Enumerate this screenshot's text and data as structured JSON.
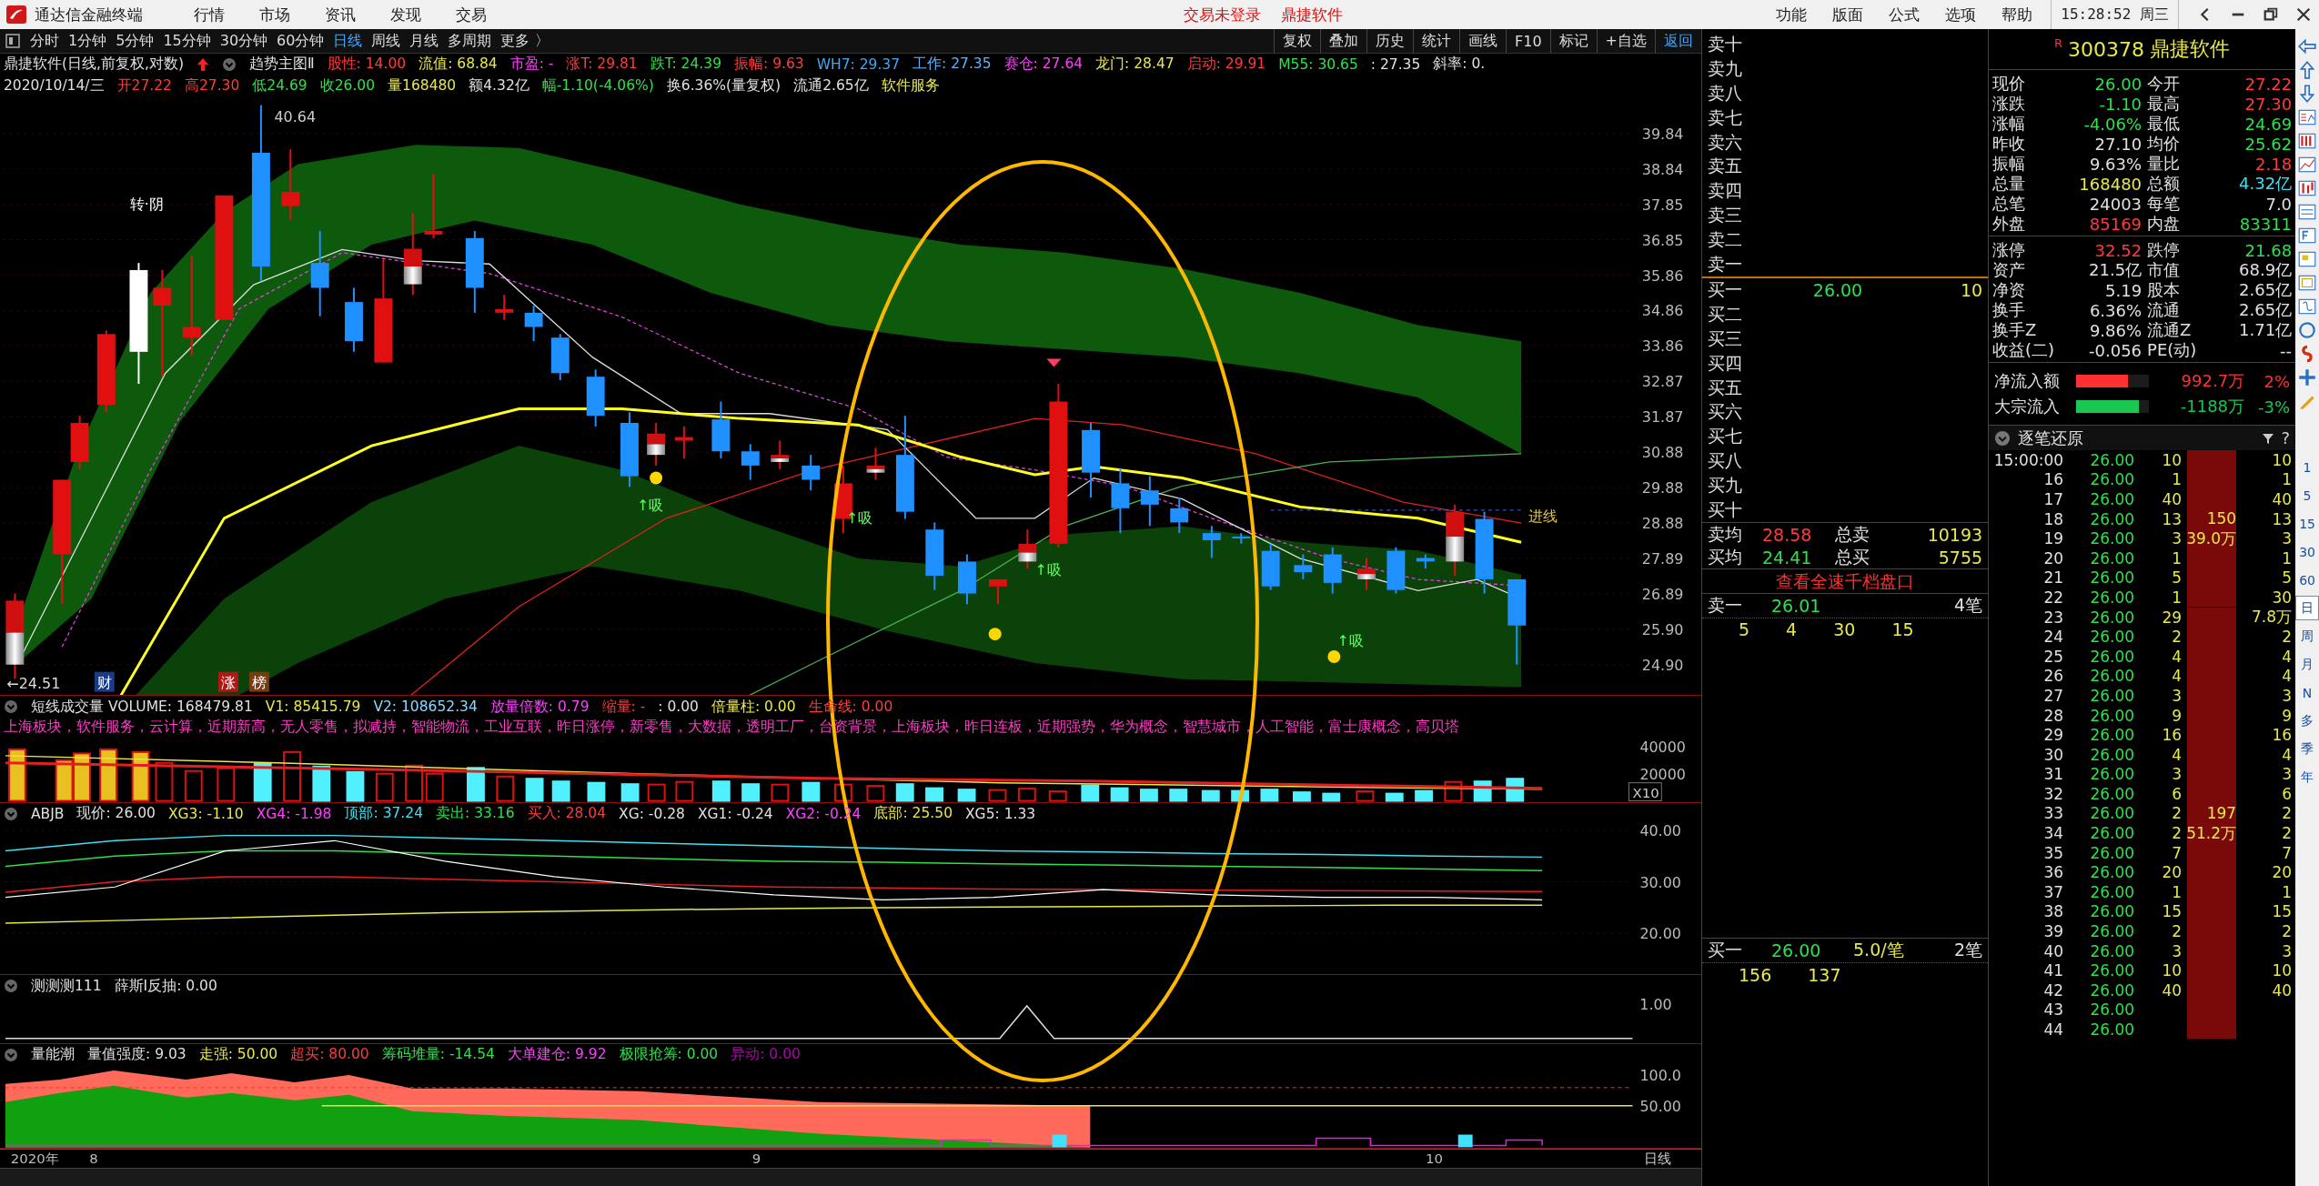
{
  "title_bar": {
    "app_name": "通达信金融终端",
    "menu": [
      "行情",
      "市场",
      "资讯",
      "发现",
      "交易"
    ],
    "notices": [
      "交易未登录",
      "鼎捷软件"
    ],
    "right_menu": [
      "功能",
      "版面",
      "公式",
      "选项",
      "帮助"
    ],
    "clock": "15:28:52 周三"
  },
  "period_tabs": [
    {
      "label": "分时",
      "selected": false
    },
    {
      "label": "1分钟",
      "selected": false
    },
    {
      "label": "5分钟",
      "selected": false
    },
    {
      "label": "15分钟",
      "selected": false
    },
    {
      "label": "30分钟",
      "selected": false
    },
    {
      "label": "60分钟",
      "selected": false
    },
    {
      "label": "日线",
      "selected": true
    },
    {
      "label": "周线",
      "selected": false
    },
    {
      "label": "月线",
      "selected": false
    },
    {
      "label": "多周期",
      "selected": false
    },
    {
      "label": "更多 〉",
      "selected": false
    }
  ],
  "tool_buttons": [
    {
      "label": "复权",
      "selected": false
    },
    {
      "label": "叠加",
      "selected": false
    },
    {
      "label": "历史",
      "selected": false
    },
    {
      "label": "统计",
      "selected": false
    },
    {
      "label": "画线",
      "selected": false
    },
    {
      "label": "F10",
      "selected": false
    },
    {
      "label": "标记",
      "selected": false
    },
    {
      "label": "+自选",
      "selected": false
    },
    {
      "label": "返回",
      "selected": true
    }
  ],
  "main_chart": {
    "title": "鼎捷软件(日线,前复权,对数)",
    "indicator_name": "趋势主图Ⅱ",
    "indicators": [
      {
        "text": "股性: 14.00",
        "color": "#ff3b3b"
      },
      {
        "text": "流值: 68.84",
        "color": "#e8e84a"
      },
      {
        "text": "市盈: -",
        "color": "#ff40ff"
      },
      {
        "text": "涨T: 29.81",
        "color": "#ff3b3b"
      },
      {
        "text": "跌T: 24.39",
        "color": "#2ee04a"
      },
      {
        "text": "振幅: 9.63",
        "color": "#ff3b3b"
      },
      {
        "text": "WH7: 29.37",
        "color": "#3fa9f5"
      },
      {
        "text": "工作: 27.35",
        "color": "#5ab4ff"
      },
      {
        "text": "赛仓: 27.64",
        "color": "#ff40ff"
      },
      {
        "text": "龙门: 28.47",
        "color": "#e8e84a"
      },
      {
        "text": "启动: 29.91",
        "color": "#ff3b3b"
      },
      {
        "text": "M55: 30.65",
        "color": "#2ee04a"
      },
      {
        "text": ": 27.35",
        "color": "#e0e0e0"
      },
      {
        "text": "斜率: 0.",
        "color": "#e0e0e0"
      }
    ],
    "date_line": [
      {
        "text": "2020/10/14/三",
        "color": "#e0e0e0"
      },
      {
        "text": "开27.22",
        "color": "#ff3b3b"
      },
      {
        "text": "高27.30",
        "color": "#ff3b3b"
      },
      {
        "text": "低24.69",
        "color": "#2ee04a"
      },
      {
        "text": "收26.00",
        "color": "#2ee04a"
      },
      {
        "text": "量168480",
        "color": "#e8e84a"
      },
      {
        "text": "额4.32亿",
        "color": "#e0e0e0"
      },
      {
        "text": "幅-1.10(-4.06%)",
        "color": "#2ee04a"
      },
      {
        "text": "换6.36%(量复权)",
        "color": "#e0e0e0"
      },
      {
        "text": "流通2.65亿",
        "color": "#e0e0e0"
      },
      {
        "text": "软件服务",
        "color": "#e8e84a"
      }
    ],
    "price_axis": [
      "39.84",
      "38.84",
      "37.85",
      "36.85",
      "35.86",
      "34.86",
      "33.86",
      "32.87",
      "31.87",
      "30.88",
      "29.88",
      "28.88",
      "27.89",
      "26.89",
      "25.90",
      "24.90"
    ],
    "high_label": "40.64",
    "low_label": "←24.51",
    "turn_label": "转·阴",
    "marks": [
      {
        "text": "财",
        "color": "#1a3a8a"
      },
      {
        "text": "涨",
        "color": "#b01818"
      },
      {
        "text": "榜",
        "color": "#7a3a10"
      }
    ],
    "buy_signals": [
      "↑吸",
      "↑吸",
      "↑吸",
      "↑吸"
    ],
    "entry_label": "进线"
  },
  "volume_panel": {
    "values": [
      {
        "text": "短线成交量 VOLUME: 168479.81",
        "color": "#e0e0e0"
      },
      {
        "text": "V1: 85415.79",
        "color": "#e8e84a"
      },
      {
        "text": "V2: 108652.34",
        "color": "#8fd8ff"
      },
      {
        "text": "放量倍数: 0.79",
        "color": "#ff40ff"
      },
      {
        "text": "缩量: -",
        "color": "#ff3b3b"
      },
      {
        "text": ": 0.00",
        "color": "#e0e0e0"
      },
      {
        "text": "倍量柱: 0.00",
        "color": "#e8e84a"
      },
      {
        "text": "生命线: 0.00",
        "color": "#ff3b3b"
      }
    ],
    "concepts": "上海板块，软件服务，云计算，近期新高，无人零售，拟减持，智能物流，工业互联，昨日涨停，新零售，大数据，透明工厂，台资背景，上海板块，昨日连板，近期强势，华为概念，智慧城市，人工智能，富士康概念，高贝塔",
    "axis": [
      "40000",
      "20000"
    ],
    "scale_tag": "X10"
  },
  "abjb_panel": {
    "values": [
      {
        "text": "ABJB",
        "color": "#e0e0e0"
      },
      {
        "text": "现价: 26.00",
        "color": "#e0e0e0"
      },
      {
        "text": "XG3: -1.10",
        "color": "#e8e84a"
      },
      {
        "text": "XG4: -1.98",
        "color": "#ff40ff"
      },
      {
        "text": "顶部: 37.24",
        "color": "#40e0f0"
      },
      {
        "text": "卖出: 33.16",
        "color": "#2ee04a"
      },
      {
        "text": "买入: 28.04",
        "color": "#ff3b3b"
      },
      {
        "text": "XG: -0.28",
        "color": "#e0e0e0"
      },
      {
        "text": "XG1: -0.24",
        "color": "#e0e0e0"
      },
      {
        "text": "XG2: -0.24",
        "color": "#ff40ff"
      },
      {
        "text": "底部: 25.50",
        "color": "#e8e84a"
      },
      {
        "text": "XG5: 1.33",
        "color": "#e0e0e0"
      }
    ],
    "axis": [
      "40.00",
      "30.00",
      "20.00"
    ]
  },
  "test_panel": {
    "values": [
      {
        "text": "测测测111",
        "color": "#e0e0e0"
      },
      {
        "text": "薛斯Ⅰ反抽: 0.00",
        "color": "#e0e0e0"
      }
    ],
    "axis": [
      "1.00"
    ]
  },
  "energy_panel": {
    "values": [
      {
        "text": "量能潮",
        "color": "#e0e0e0"
      },
      {
        "text": "量值强度: 9.03",
        "color": "#e0e0e0"
      },
      {
        "text": "走强: 50.00",
        "color": "#e8e84a"
      },
      {
        "text": "超买: 80.00",
        "color": "#ff3b3b"
      },
      {
        "text": "筹码堆量: -14.54",
        "color": "#2ee04a"
      },
      {
        "text": "大单建仓: 9.92",
        "color": "#ff40ff"
      },
      {
        "text": "极限抢筹: 0.00",
        "color": "#2ee04a"
      },
      {
        "text": "异动: 0.00",
        "color": "#b000b0"
      }
    ],
    "axis": [
      "100.0",
      "50.00"
    ]
  },
  "date_axis": {
    "labels": [
      "2020年",
      "8",
      "9",
      "10"
    ],
    "period": "日线"
  },
  "order_book": {
    "asks": [
      "卖十",
      "卖九",
      "卖八",
      "卖七",
      "卖六",
      "卖五",
      "卖四",
      "卖三",
      "卖二",
      "卖一"
    ],
    "bids": [
      {
        "label": "买一",
        "price": "26.00",
        "volume": "10"
      },
      {
        "label": "买二"
      },
      {
        "label": "买三"
      },
      {
        "label": "买四"
      },
      {
        "label": "买五"
      },
      {
        "label": "买六"
      },
      {
        "label": "买七"
      },
      {
        "label": "买八"
      },
      {
        "label": "买九"
      },
      {
        "label": "买十"
      }
    ],
    "summary": [
      {
        "label": "卖均",
        "value": "28.58",
        "color": "#ff3b3b",
        "label2": "总卖",
        "value2": "10193"
      },
      {
        "label": "买均",
        "value": "24.41",
        "color": "#2ee04a",
        "label2": "总买",
        "value2": "5755"
      }
    ],
    "full_depth_button": "查看全速千档盘口",
    "ask1": {
      "label": "卖一",
      "price": "26.01",
      "count": "4笔",
      "orders": [
        "5",
        "4",
        "30",
        "15"
      ]
    },
    "bid1": {
      "label": "买一",
      "price": "26.00",
      "average": "5.0/笔",
      "count": "2笔",
      "orders": [
        "156",
        "137"
      ]
    }
  },
  "quote": {
    "badge": "R",
    "code": "300378",
    "name": "鼎捷软件",
    "rows": [
      {
        "cells": [
          {
            "label": "现价",
            "value": "26.00",
            "color": "#2ee04a"
          },
          {
            "label": "今开",
            "value": "27.22",
            "color": "#ff3b3b"
          }
        ]
      },
      {
        "cells": [
          {
            "label": "涨跌",
            "value": "-1.10",
            "color": "#2ee04a"
          },
          {
            "label": "最高",
            "value": "27.30",
            "color": "#ff3b3b"
          }
        ]
      },
      {
        "cells": [
          {
            "label": "涨幅",
            "value": "-4.06%",
            "color": "#2ee04a"
          },
          {
            "label": "最低",
            "value": "24.69",
            "color": "#2ee04a"
          }
        ]
      },
      {
        "cells": [
          {
            "label": "昨收",
            "value": "27.10",
            "color": "#e0e0e0"
          },
          {
            "label": "均价",
            "value": "25.62",
            "color": "#2ee04a"
          }
        ]
      },
      {
        "cells": [
          {
            "label": "振幅",
            "value": "9.63%",
            "color": "#e0e0e0"
          },
          {
            "label": "量比",
            "value": "2.18",
            "color": "#ff3b3b"
          }
        ]
      },
      {
        "cells": [
          {
            "label": "总量",
            "value": "168480",
            "color": "#e8e84a"
          },
          {
            "label": "总额",
            "value": "4.32亿",
            "color": "#40e0f0"
          }
        ]
      },
      {
        "cells": [
          {
            "label": "总笔",
            "value": "24003",
            "color": "#e0e0e0"
          },
          {
            "label": "每笔",
            "value": "7.0",
            "color": "#e0e0e0"
          }
        ]
      },
      {
        "cells": [
          {
            "label": "外盘",
            "value": "85169",
            "color": "#ff3b3b"
          },
          {
            "label": "内盘",
            "value": "83311",
            "color": "#2ee04a"
          }
        ]
      }
    ],
    "rows2": [
      {
        "cells": [
          {
            "label": "涨停",
            "value": "32.52",
            "color": "#ff3b3b"
          },
          {
            "label": "跌停",
            "value": "21.68",
            "color": "#2ee04a"
          }
        ]
      },
      {
        "cells": [
          {
            "label": "资产",
            "value": "21.5亿",
            "color": "#e0e0e0"
          },
          {
            "label": "市值",
            "value": "68.9亿",
            "color": "#e0e0e0"
          }
        ]
      },
      {
        "cells": [
          {
            "label": "净资",
            "value": "5.19",
            "color": "#e0e0e0"
          },
          {
            "label": "股本",
            "value": "2.65亿",
            "color": "#e0e0e0"
          }
        ]
      },
      {
        "cells": [
          {
            "label": "换手",
            "value": "6.36%",
            "color": "#e0e0e0"
          },
          {
            "label": "流通",
            "value": "2.65亿",
            "color": "#e0e0e0"
          }
        ]
      },
      {
        "cells": [
          {
            "label": "换手Z",
            "value": "9.86%",
            "color": "#e0e0e0"
          },
          {
            "label": "流通Z",
            "value": "1.71亿",
            "color": "#e0e0e0"
          }
        ]
      },
      {
        "cells": [
          {
            "label": "收益(二)",
            "value": "-0.056",
            "color": "#e0e0e0"
          },
          {
            "label": "PE(动)",
            "value": "--",
            "color": "#e0e0e0"
          }
        ]
      }
    ],
    "flows": [
      {
        "label": "净流入额",
        "level": 0.71,
        "color": "#ff3030",
        "amount": "992.7万",
        "percent": "2%"
      },
      {
        "label": "大宗流入",
        "level": 0.86,
        "color": "#18c850",
        "amount": "-1188万",
        "percent": "-3%"
      }
    ]
  },
  "tick_list": {
    "title": "逐笔还原",
    "help": "?",
    "groups": [
      {
        "lines": [
          "150",
          "39.0万"
        ],
        "rows": [
          {
            "time": "15:00:00",
            "price": "26.00",
            "volume": "10",
            "column_5": "10"
          },
          {
            "time": "16",
            "price": "26.00",
            "volume": "1",
            "column_5": "1"
          },
          {
            "time": "17",
            "price": "26.00",
            "volume": "40",
            "column_5": "40"
          },
          {
            "time": "18",
            "price": "26.00",
            "volume": "13",
            "column_5": "13"
          },
          {
            "time": "19",
            "price": "26.00",
            "volume": "3",
            "column_5": "3"
          },
          {
            "time": "20",
            "price": "26.00",
            "volume": "1",
            "column_5": "1"
          },
          {
            "time": "21",
            "price": "26.00",
            "volume": "5",
            "column_5": "5"
          },
          {
            "time": "22",
            "price": "26.00",
            "volume": "1",
            "column_5": "30"
          }
        ]
      },
      {
        "lines": [
          "197",
          "51.2万"
        ],
        "rows": [
          {
            "time": "23",
            "price": "26.00",
            "volume": "29",
            "column_5": "7.8万"
          },
          {
            "time": "24",
            "price": "26.00",
            "volume": "2",
            "column_5": "2"
          },
          {
            "time": "25",
            "price": "26.00",
            "volume": "4",
            "column_5": "4"
          },
          {
            "time": "26",
            "price": "26.00",
            "volume": "4",
            "column_5": "4"
          },
          {
            "time": "27",
            "price": "26.00",
            "volume": "3",
            "column_5": "3"
          },
          {
            "time": "28",
            "price": "26.00",
            "volume": "9",
            "column_5": "9"
          },
          {
            "time": "29",
            "price": "26.00",
            "volume": "16",
            "column_5": "16"
          },
          {
            "time": "30",
            "price": "26.00",
            "volume": "4",
            "column_5": "4"
          },
          {
            "time": "31",
            "price": "26.00",
            "volume": "3",
            "column_5": "3"
          },
          {
            "time": "32",
            "price": "26.00",
            "volume": "6",
            "column_5": "6"
          },
          {
            "time": "33",
            "price": "26.00",
            "volume": "2",
            "column_5": "2"
          },
          {
            "time": "34",
            "price": "26.00",
            "volume": "2",
            "column_5": "2"
          },
          {
            "time": "35",
            "price": "26.00",
            "volume": "7",
            "column_5": "7"
          },
          {
            "time": "36",
            "price": "26.00",
            "volume": "20",
            "column_5": "20"
          },
          {
            "time": "37",
            "price": "26.00",
            "volume": "1",
            "column_5": "1"
          },
          {
            "time": "38",
            "price": "26.00",
            "volume": "15",
            "column_5": "15"
          },
          {
            "time": "39",
            "price": "26.00",
            "volume": "2",
            "column_5": "2"
          },
          {
            "time": "40",
            "price": "26.00",
            "volume": "3",
            "column_5": "3"
          },
          {
            "time": "41",
            "price": "26.00",
            "volume": "10",
            "column_5": "10"
          },
          {
            "time": "42",
            "price": "26.00",
            "volume": "40",
            "column_5": "40"
          },
          {
            "time": "43",
            "price": "26.00"
          },
          {
            "time": "44",
            "price": "26.00"
          }
        ]
      }
    ]
  },
  "side_toolbar": {
    "periods": [
      {
        "label": "1",
        "selected": false
      },
      {
        "label": "5",
        "selected": false
      },
      {
        "label": "15",
        "selected": false
      },
      {
        "label": "30",
        "selected": false
      },
      {
        "label": "60",
        "selected": false
      },
      {
        "label": "日",
        "selected": true
      },
      {
        "label": "周",
        "selected": false
      },
      {
        "label": "月",
        "selected": false
      },
      {
        "label": "N",
        "selected": false
      },
      {
        "label": "多",
        "selected": false
      },
      {
        "label": "季",
        "selected": false
      },
      {
        "label": "年",
        "selected": false
      }
    ]
  }
}
